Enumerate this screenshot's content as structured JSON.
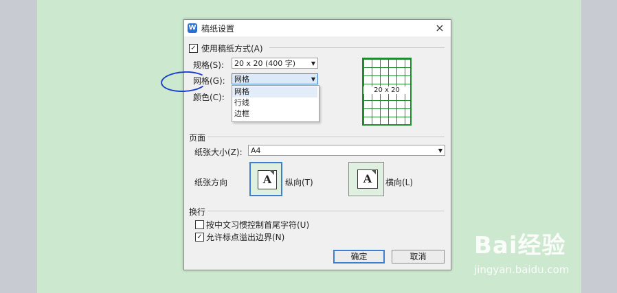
{
  "dialog": {
    "title": "稿纸设置",
    "app_icon_letter": "W",
    "close_glyph": "×"
  },
  "manuscript": {
    "use_label": "使用稿纸方式(A)",
    "use_checked": true,
    "spec_label": "规格(S):",
    "spec_value": "20 x 20 (400 字)",
    "grid_label": "网格(G):",
    "grid_value": "网格",
    "grid_options": [
      "网格",
      "行线",
      "边框"
    ],
    "color_label": "颜色(C):",
    "preview_text": "20 x 20"
  },
  "page": {
    "section_label": "页面",
    "size_label": "纸张大小(Z):",
    "size_value": "A4",
    "orientation_label": "纸张方向",
    "portrait_label": "纵向(T)",
    "landscape_label": "横向(L)",
    "orientation_glyph": "A",
    "selected_orientation": "portrait"
  },
  "wrap": {
    "section_label": "换行",
    "option1_label": "按中文习惯控制首尾字符(U)",
    "option1_checked": false,
    "option2_label": "允许标点溢出边界(N)",
    "option2_checked": true
  },
  "buttons": {
    "ok": "确定",
    "cancel": "取消"
  },
  "watermark": {
    "brand": "Bai经验",
    "url": "jingyan.baidu.com"
  },
  "colors": {
    "page_background": "#cce8cf",
    "side_background": "#c8cbd2",
    "preview_green": "#1f8a2e",
    "focus_blue": "#3c7fd1",
    "annotation_blue": "#1a3fd0"
  }
}
